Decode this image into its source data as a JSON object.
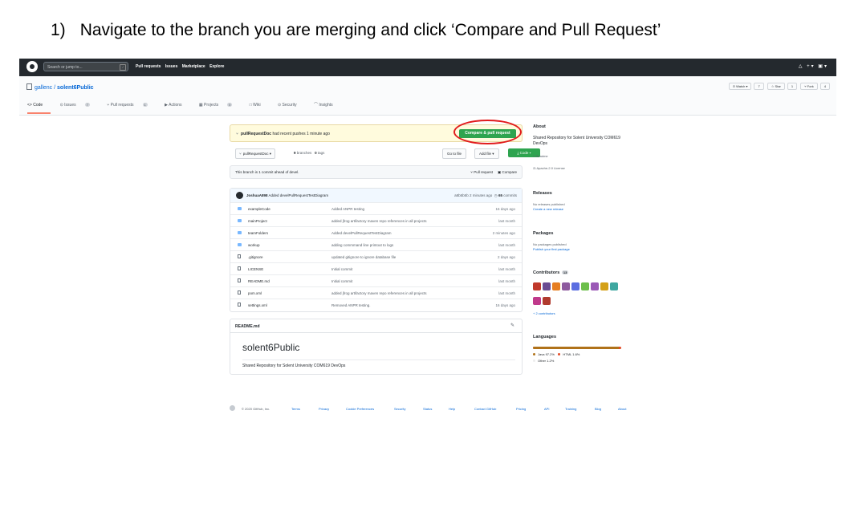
{
  "instruction": {
    "number": "1)",
    "text": "Navigate to the branch you are merging and click ‘Compare and Pull Request’"
  },
  "colors": {
    "github_dark": "#24292e",
    "green": "#2ea44f",
    "link": "#0366d6",
    "highlight_circle": "#e11b1b"
  },
  "topbar": {
    "search_placeholder": "Search or jump to...",
    "nav": [
      "Pull requests",
      "Issues",
      "Marketplace",
      "Explore"
    ],
    "right_icons": "△ +▾ ▣▾"
  },
  "repo": {
    "owner": "gallenc",
    "name": "solent6Public",
    "watch": "⊙ Watch ▾",
    "watch_count": "7",
    "star": "☆ Star",
    "star_count": "1",
    "fork": "⑂ Fork",
    "fork_count": "4"
  },
  "tabs": [
    {
      "label": "<> Code",
      "count": ""
    },
    {
      "label": "⊙ Issues",
      "count": "7"
    },
    {
      "label": "⑂ Pull requests",
      "count": "1"
    },
    {
      "label": "▶ Actions",
      "count": ""
    },
    {
      "label": "▦ Projects",
      "count": "0"
    },
    {
      "label": "□ Wiki",
      "count": ""
    },
    {
      "label": "⊙ Security",
      "count": ""
    },
    {
      "label": "⌒ Insights",
      "count": ""
    }
  ],
  "flash": {
    "branch": "pullRequestDoc",
    "text": "had recent pushes 1 minute ago",
    "button": "Compare & pull request"
  },
  "branchbar": {
    "branch": "pullRequestDoc ▾",
    "branches_count": "9",
    "branches_label": "branches",
    "tags_count": "0",
    "tags_label": "tags",
    "goto": "Go to file",
    "addfile": "Add file ▾",
    "code": "⤓ Code ▾"
  },
  "ahead": {
    "text": "This branch is 1 commit ahead of devel.",
    "pull": "⑂ Pull request",
    "compare": "▣ Compare"
  },
  "commit": {
    "author": "JoshuaA898",
    "message": "Added develPullRequestTestDiagram",
    "sha": "a8b5b5b",
    "age": "2 minutes ago",
    "commits_count": "65",
    "commits_label": "commits"
  },
  "files": [
    {
      "type": "dir",
      "name": "exampleCode",
      "msg": "Added ANPR testing",
      "age": "16 days ago"
    },
    {
      "type": "dir",
      "name": "mainProject",
      "msg": "added jfrog artifactory maven repo references in all projects",
      "age": "last month"
    },
    {
      "type": "dir",
      "name": "teamFolders",
      "msg": "Added develPullRequestTestDiagram",
      "age": "2 minutes ago"
    },
    {
      "type": "dir",
      "name": "workup",
      "msg": "adding commmand line printout to logs",
      "age": "last month"
    },
    {
      "type": "file",
      "name": ".gitignore",
      "msg": "updated gitignore to ignore database file",
      "age": "2 days ago"
    },
    {
      "type": "file",
      "name": "LICENSE",
      "msg": "Initial commit",
      "age": "last month"
    },
    {
      "type": "file",
      "name": "README.md",
      "msg": "Initial commit",
      "age": "last month"
    },
    {
      "type": "file",
      "name": "pom.xml",
      "msg": "added jfrog artifactory maven repo references in all projects",
      "age": "last month"
    },
    {
      "type": "file",
      "name": "settings.xml",
      "msg": "Removed ANPR testing.",
      "age": "16 days ago"
    }
  ],
  "readme": {
    "label": "README.md",
    "title": "solent6Public",
    "body": "Shared Repository for Solent University COM619 DevOps"
  },
  "sidebar": {
    "about_title": "About",
    "about_text": "Shared Repository for Solent University COM619 DevOps",
    "readme_link": "□ Readme",
    "license": "⚖ Apache-2.0 License",
    "releases_title": "Releases",
    "releases_none": "No releases published",
    "releases_link": "Create a new release",
    "packages_title": "Packages",
    "packages_none": "No packages published",
    "packages_link": "Publish your first package",
    "contributors_title": "Contributors",
    "contributors_count": "13",
    "contributors_more": "+ 2 contributors",
    "contributor_colors": [
      "#c0392b",
      "#6a4c93",
      "#e67e22",
      "#8e5a9e",
      "#5b6ee1",
      "#6dbf4b",
      "#9b59b6",
      "#d4a017",
      "#3fa7a0",
      "#c0398b",
      "#b03a2e"
    ],
    "languages_title": "Languages",
    "languages": [
      {
        "name": "Java",
        "pct": "97.2%",
        "color": "#b07219",
        "share": 0.972
      },
      {
        "name": "HTML",
        "pct": "1.6%",
        "color": "#e34c26",
        "share": 0.016
      },
      {
        "name": "Other",
        "pct": "1.2%",
        "color": "#ededed",
        "share": 0.012
      }
    ]
  },
  "footer": {
    "copyright": "© 2020 GitHub, Inc.",
    "links": [
      "Terms",
      "Privacy",
      "Cookie Preferences",
      "Security",
      "Status",
      "Help",
      "Contact GitHub",
      "Pricing",
      "API",
      "Training",
      "Blog",
      "About"
    ]
  }
}
